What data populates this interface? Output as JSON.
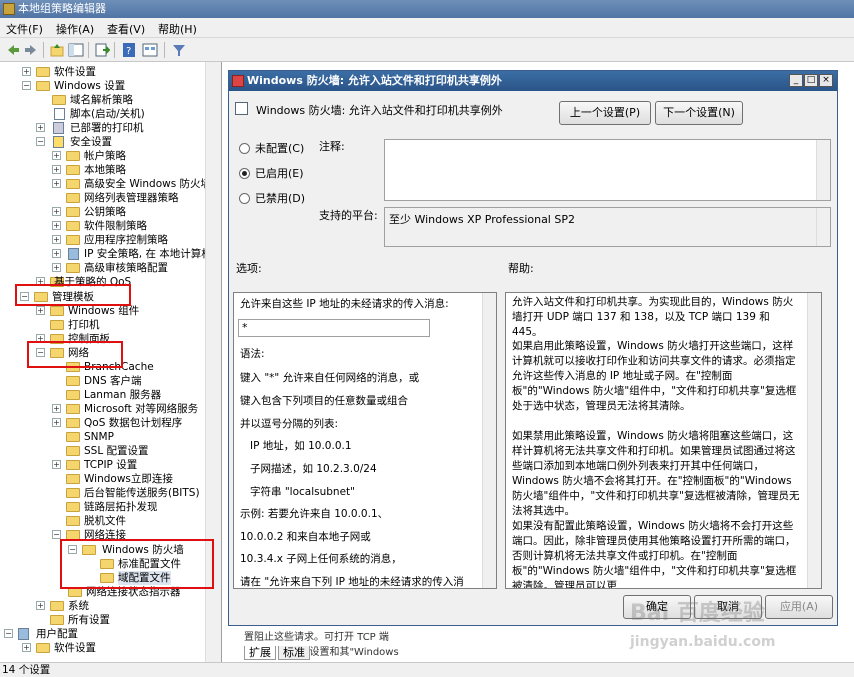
{
  "app": {
    "title": "本地组策略编辑器"
  },
  "menu": {
    "file": "文件(F)",
    "action": "操作(A)",
    "view": "查看(V)",
    "help": "帮助(H)"
  },
  "tree": {
    "items": [
      {
        "label": "软件设置"
      },
      {
        "label": "Windows 设置"
      },
      {
        "label": "域名解析策略"
      },
      {
        "label": "脚本(启动/关机)"
      },
      {
        "label": "已部署的打印机"
      },
      {
        "label": "安全设置"
      },
      {
        "label": "帐户策略"
      },
      {
        "label": "本地策略"
      },
      {
        "label": "高级安全 Windows 防火墙"
      },
      {
        "label": "网络列表管理器策略"
      },
      {
        "label": "公钥策略"
      },
      {
        "label": "软件限制策略"
      },
      {
        "label": "应用程序控制策略"
      },
      {
        "label": "IP 安全策略, 在 本地计算机"
      },
      {
        "label": "高级审核策略配置"
      },
      {
        "label": "基于策略的 QoS"
      },
      {
        "label": "管理模板"
      },
      {
        "label": "Windows 组件"
      },
      {
        "label": "打印机"
      },
      {
        "label": "控制面板"
      },
      {
        "label": "网络"
      },
      {
        "label": "BranchCache"
      },
      {
        "label": "DNS 客户端"
      },
      {
        "label": "Lanman 服务器"
      },
      {
        "label": "Microsoft 对等网络服务"
      },
      {
        "label": "QoS 数据包计划程序"
      },
      {
        "label": "SNMP"
      },
      {
        "label": "SSL 配置设置"
      },
      {
        "label": "TCPIP 设置"
      },
      {
        "label": "Windows立即连接"
      },
      {
        "label": "后台智能传送服务(BITS)"
      },
      {
        "label": "链路层拓扑发现"
      },
      {
        "label": "脱机文件"
      },
      {
        "label": "网络连接"
      },
      {
        "label": "Windows 防火墙"
      },
      {
        "label": "标准配置文件"
      },
      {
        "label": "域配置文件"
      },
      {
        "label": "网络连接状态指示器"
      },
      {
        "label": "系统"
      },
      {
        "label": "所有设置"
      },
      {
        "label": "用户配置"
      },
      {
        "label": "软件设置"
      }
    ]
  },
  "dialog": {
    "title": "Windows 防火墙: 允许入站文件和打印机共享例外",
    "header": "Windows 防火墙: 允许入站文件和打印机共享例外",
    "prev_button": "上一个设置(P)",
    "next_button": "下一个设置(N)",
    "radio_not_configured": "未配置(C)",
    "radio_enabled": "已启用(E)",
    "radio_disabled": "已禁用(D)",
    "comment_label": "注释:",
    "platform_label": "支持的平台:",
    "platform_value": "至少 Windows XP Professional SP2",
    "options_label": "选项:",
    "help_label": "帮助:",
    "ok_button": "确定",
    "cancel_button": "取消",
    "apply_button": "应用(A)",
    "options": {
      "line1": "允许来自这些 IP 地址的未经请求的传入消息:",
      "input_value": "*",
      "syntax": "语法:",
      "l1": "键入 \"*\" 允许来自任何网络的消息，或",
      "l2": "键入包含下列项目的任意数量或组合",
      "l3": "并以逗号分隔的列表:",
      "l4": "IP 地址，如 10.0.0.1",
      "l5": "子网描述，如 10.2.3.0/24",
      "l6": "字符串 \"localsubnet\"",
      "l7": "示例: 若要允许来自 10.0.0.1、",
      "l8": "10.0.0.2 和来自本地子网或",
      "l9": "10.3.4.x 子网上任何系统的消息，",
      "l10": "请在 \"允许来自下列 IP 地址的未经请求的传入消"
    },
    "help": {
      "p1": "允许入站文件和打印机共享。为实现此目的，Windows 防火墙打开 UDP 端口 137 和 138，以及 TCP 端口 139 和 445。",
      "p2": "如果启用此策略设置，Windows 防火墙打开这些端口，这样计算机就可以接收打印作业和访问共享文件的请求。必须指定允许这些传入消息的 IP 地址或子网。在\"控制面板\"的\"Windows 防火墙\"组件中，\"文件和打印机共享\"复选框处于选中状态，管理员无法将其清除。",
      "p3": "如果禁用此策略设置，Windows 防火墙将阻塞这些端口，这样计算机将无法共享文件和打印机。如果管理员试图通过将这些端口添加到本地端口例外列表来打开其中任何端口，Windows 防火墙不会将其打开。在\"控制面板\"的\"Windows 防火墙\"组件中，\"文件和打印机共享\"复选框被清除，管理员无法将其选中。",
      "p4": "如果没有配置此策略设置，Windows 防火墙将不会打开这些端口。因此，除非管理员使用其他策略设置打开所需的端口，否则计算机将无法共享文件或打印机。在\"控制面板\"的\"Windows 防火墙\"组件中，\"文件和打印机共享\"复选框被清除。管理员可以更"
    }
  },
  "behind": {
    "line1": "置阻止这些请求。可打开 TCP 端",
    "line2": "口 445 的策略设置和其\"Windows"
  },
  "tabs": {
    "extended": "扩展",
    "standard": "标准"
  },
  "status": {
    "text": "14 个设置"
  },
  "watermark": {
    "line1": "Bai 百度经验",
    "line2": "jingyan.baidu.com"
  }
}
